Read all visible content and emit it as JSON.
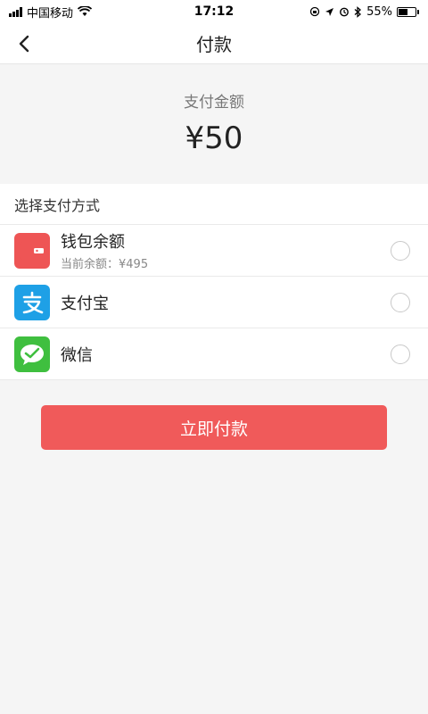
{
  "status_bar": {
    "carrier": "中国移动",
    "time": "17:12",
    "battery": "55%",
    "battery_level": 0.55
  },
  "nav": {
    "title": "付款",
    "back_icon": "chevron-left-icon"
  },
  "amount": {
    "label": "支付金额",
    "value": "¥50"
  },
  "methods": {
    "header": "选择支付方式",
    "items": [
      {
        "name": "钱包余额",
        "sub": "当前余额：¥495",
        "icon": "wallet-icon",
        "icon_color": "#ee5555"
      },
      {
        "name": "支付宝",
        "icon": "alipay-icon",
        "icon_color": "#1ea0e6"
      },
      {
        "name": "微信",
        "icon": "wechat-icon",
        "icon_color": "#3fbf3f"
      }
    ]
  },
  "pay_button": {
    "label": "立即付款",
    "color": "#f05a5a"
  }
}
